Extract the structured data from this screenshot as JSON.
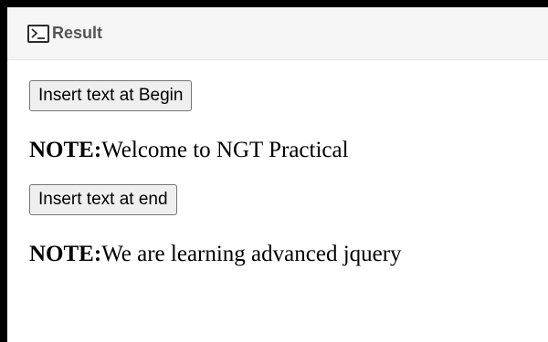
{
  "panel": {
    "title": "Result",
    "icon": "console-icon"
  },
  "controls": {
    "begin_button_label": "Insert text at Begin",
    "end_button_label": "Insert text at end"
  },
  "notes": [
    {
      "label": "NOTE:",
      "text": "Welcome to NGT Practical"
    },
    {
      "label": "NOTE:",
      "text": "We are learning advanced jquery"
    }
  ]
}
